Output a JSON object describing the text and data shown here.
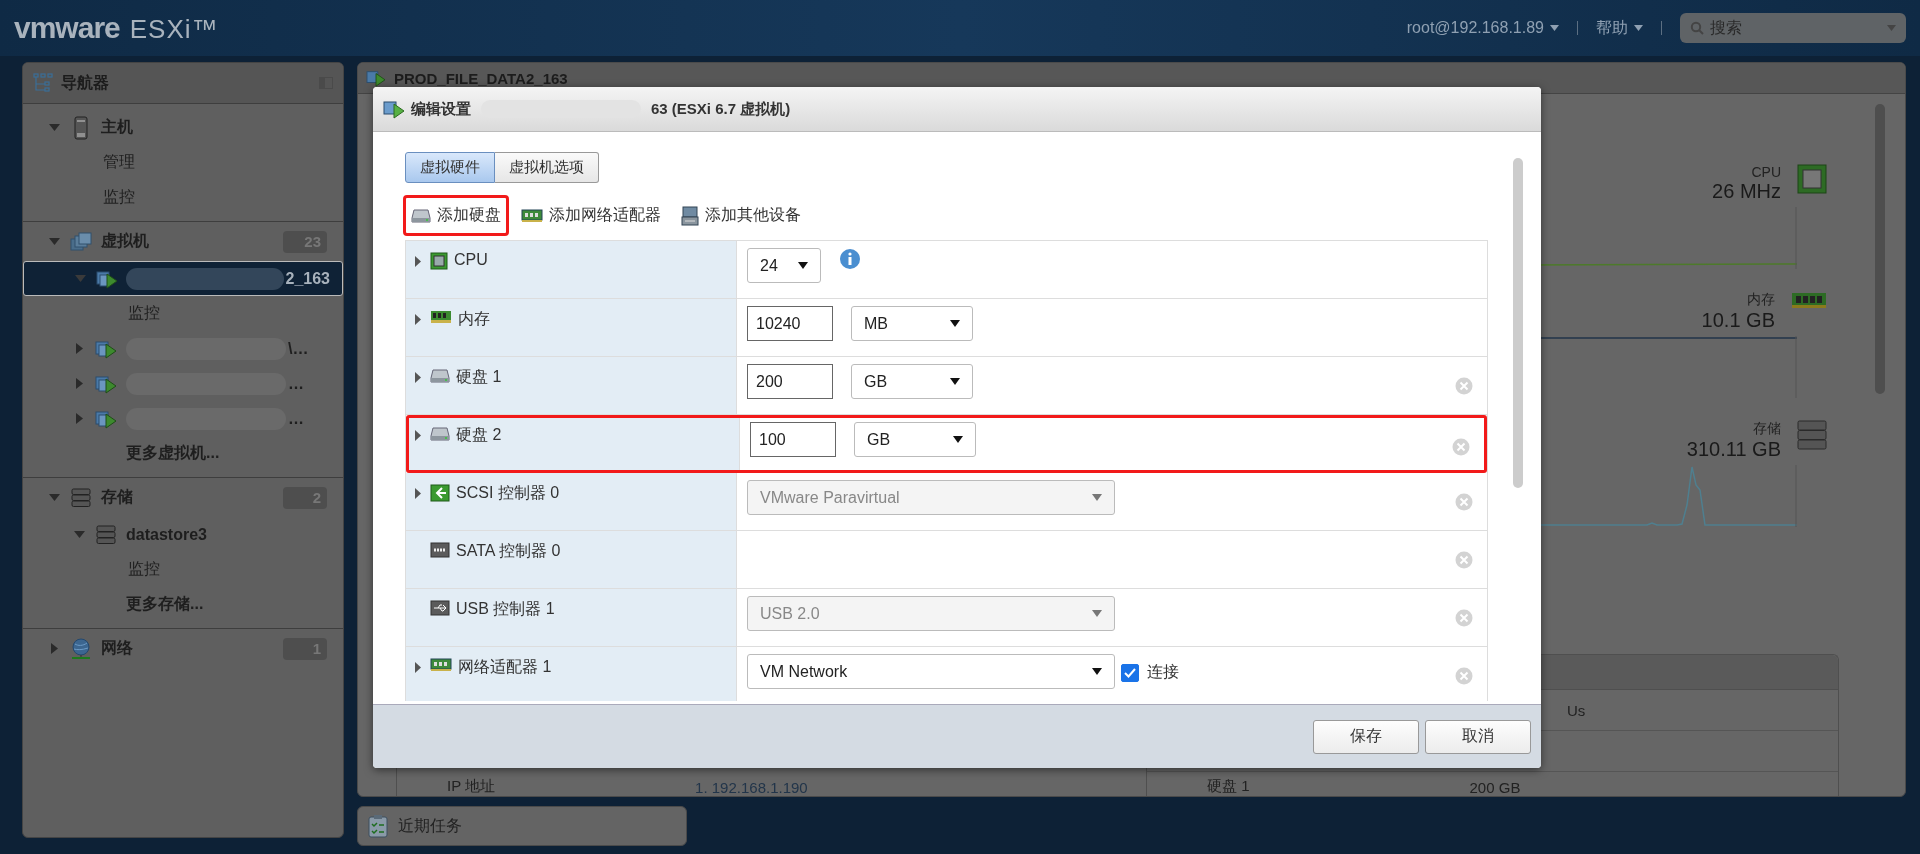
{
  "header": {
    "logo": {
      "brand": "vmware",
      "product": "ESXi™"
    },
    "user_menu": "root@192.168.1.89",
    "help_menu": "帮助",
    "search": {
      "placeholder": "搜索"
    }
  },
  "navigator": {
    "title": "导航器",
    "items": [
      {
        "label": "主机",
        "kind": "host",
        "expanded": true,
        "selected": false,
        "children": [
          {
            "label": "管理",
            "selected": false
          },
          {
            "label": "监控",
            "selected": false
          }
        ]
      },
      {
        "label": "虚拟机",
        "kind": "vm-group",
        "expanded": true,
        "selected": false,
        "count": "23",
        "children": [
          {
            "label": "2_163",
            "kind": "vm",
            "redacted": true,
            "expanded": true,
            "selected": true,
            "children": [
              {
                "label": "监控",
                "selected": false
              }
            ]
          },
          {
            "label": "\\…",
            "kind": "vm",
            "redacted": true,
            "expanded": false,
            "selected": false
          },
          {
            "label": "…",
            "kind": "vm",
            "redacted": true,
            "expanded": false,
            "selected": false
          },
          {
            "label": "…",
            "kind": "vm",
            "redacted": true,
            "expanded": false,
            "selected": false
          },
          {
            "label": "更多虚拟机...",
            "kind": "more",
            "selected": false
          }
        ]
      },
      {
        "label": "存储",
        "kind": "storage",
        "expanded": true,
        "selected": false,
        "count": "2",
        "children": [
          {
            "label": "datastore3",
            "kind": "datastore",
            "expanded": true,
            "selected": false,
            "children": [
              {
                "label": "监控",
                "selected": false
              }
            ]
          },
          {
            "label": "更多存储...",
            "kind": "more",
            "selected": false
          }
        ]
      },
      {
        "label": "网络",
        "kind": "network",
        "expanded": false,
        "selected": false,
        "count": "1"
      }
    ]
  },
  "main_panel": {
    "title": "PROD_FILE_DATA2_163",
    "stats": [
      {
        "kind": "cpu",
        "label": "CPU",
        "value": "26 MHz"
      },
      {
        "kind": "memory",
        "label": "内存",
        "value": "10.1 GB"
      },
      {
        "kind": "storage",
        "label": "存储",
        "value": "310.11 GB"
      }
    ],
    "info_left": {
      "label": "IP 地址",
      "value": "1. 192.168.1.190"
    },
    "info_right": {
      "first_cell": "Us",
      "last_row": {
        "label": "硬盘 1",
        "value": "200 GB"
      }
    },
    "recent_tasks": "近期任务"
  },
  "dialog": {
    "title_prefix": "编辑设置",
    "title_redacted": true,
    "title_suffix": "63 (ESXi 6.7 虚拟机)",
    "tabs": [
      {
        "label": "虚拟硬件",
        "selected": true
      },
      {
        "label": "虚拟机选项",
        "selected": false
      }
    ],
    "toolbar": [
      {
        "label": "添加硬盘",
        "kind": "disk",
        "highlighted": true
      },
      {
        "label": "添加网络适配器",
        "kind": "network",
        "highlighted": false
      },
      {
        "label": "添加其他设备",
        "kind": "other",
        "highlighted": false
      }
    ],
    "devices": [
      {
        "label": "CPU",
        "kind": "cpu",
        "expandable": true,
        "select": "24",
        "info": true,
        "highlighted": false
      },
      {
        "label": "内存",
        "kind": "memory",
        "expandable": true,
        "value": "10240",
        "unit": "MB",
        "highlighted": false
      },
      {
        "label": "硬盘 1",
        "kind": "disk",
        "expandable": true,
        "value": "200",
        "unit": "GB",
        "removable": true,
        "highlighted": false
      },
      {
        "label": "硬盘 2",
        "kind": "disk",
        "expandable": true,
        "value": "100",
        "unit": "GB",
        "removable": true,
        "highlighted": true
      },
      {
        "label": "SCSI 控制器 0",
        "kind": "scsi",
        "expandable": true,
        "select": "VMware Paravirtual",
        "disabled": true,
        "removable": true,
        "highlighted": false
      },
      {
        "label": "SATA 控制器 0",
        "kind": "sata",
        "expandable": false,
        "removable": true,
        "highlighted": false
      },
      {
        "label": "USB 控制器 1",
        "kind": "usb",
        "expandable": false,
        "select": "USB 2.0",
        "disabled": true,
        "removable": true,
        "highlighted": false
      },
      {
        "label": "网络适配器 1",
        "kind": "network",
        "expandable": true,
        "select": "VM Network",
        "connected": true,
        "connect_label": "连接",
        "removable": true,
        "highlighted": false
      }
    ],
    "buttons": [
      {
        "label": "保存"
      },
      {
        "label": "取消"
      }
    ]
  }
}
